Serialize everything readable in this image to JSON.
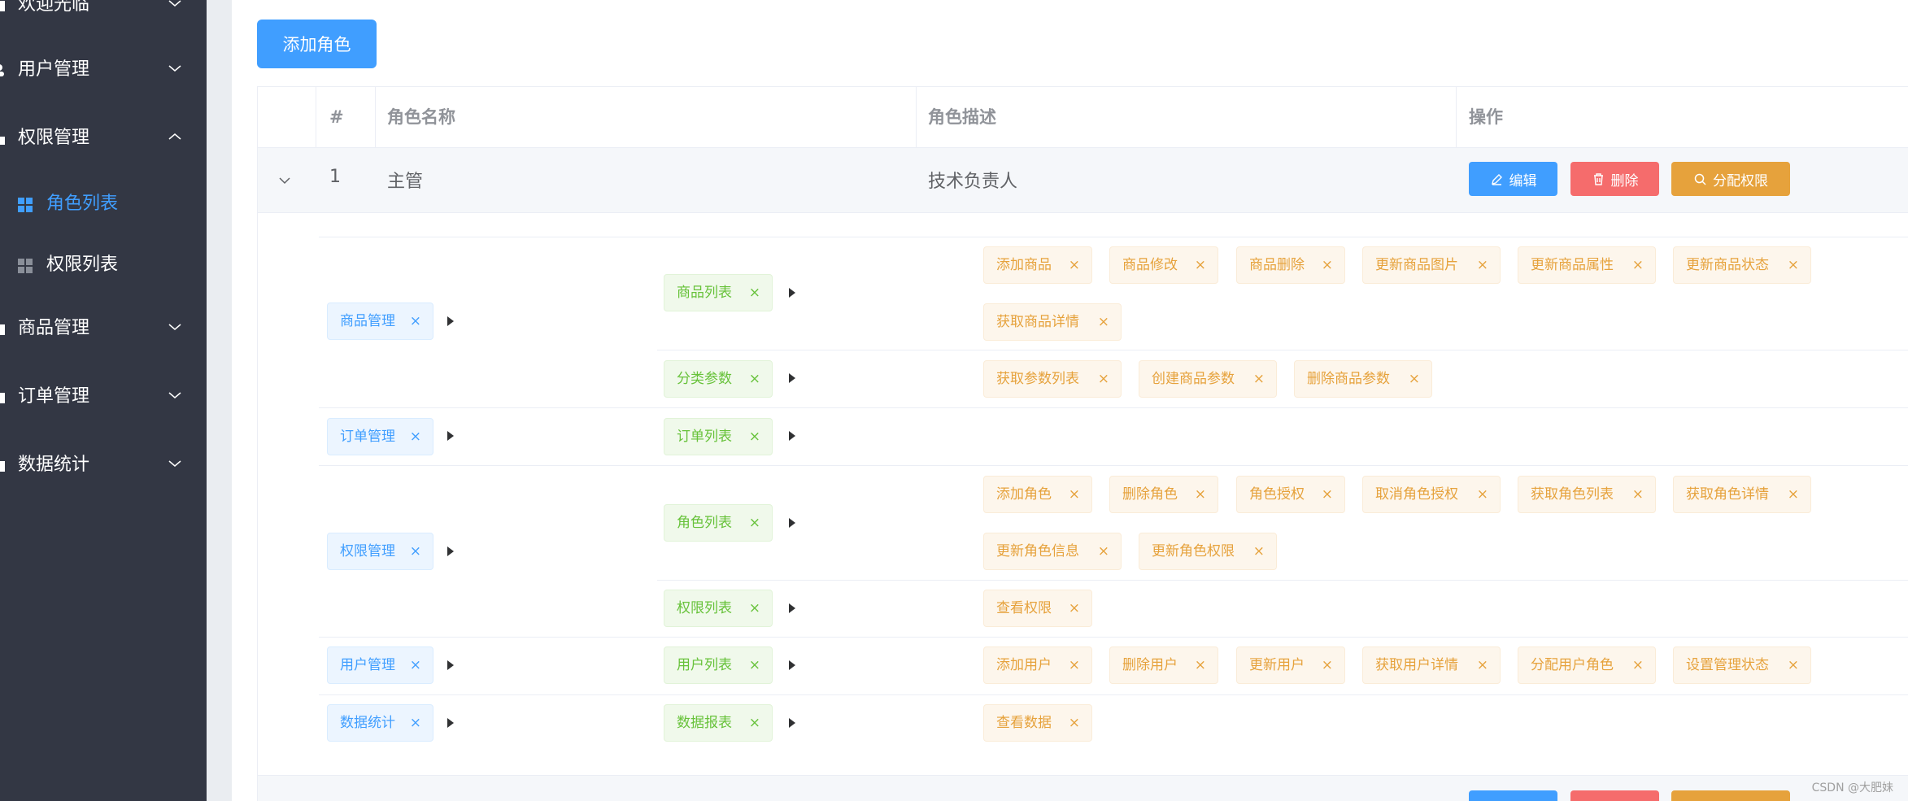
{
  "sidebar": {
    "items": [
      {
        "label": "欢迎光临"
      },
      {
        "label": "用户管理"
      },
      {
        "label": "权限管理"
      },
      {
        "label": "角色列表"
      },
      {
        "label": "权限列表"
      },
      {
        "label": "商品管理"
      },
      {
        "label": "订单管理"
      },
      {
        "label": "数据统计"
      }
    ],
    "active_color": "#409eff",
    "bg_color": "#333744"
  },
  "toolbar": {
    "add_role_label": "添加角色"
  },
  "table": {
    "headers": [
      "#",
      "角色名称",
      "角色描述",
      "操作"
    ],
    "rows": [
      {
        "index": "1",
        "name": "主管",
        "desc": "技术负责人"
      }
    ],
    "actions": {
      "edit": "编辑",
      "delete": "删除",
      "assign": "分配权限"
    }
  },
  "expanded": {
    "groups": [
      {
        "level1": "商品管理",
        "children": [
          {
            "level2": "商品列表",
            "perms": [
              "添加商品",
              "商品修改",
              "商品删除",
              "更新商品图片",
              "更新商品属性",
              "更新商品状态",
              "获取商品详情"
            ]
          },
          {
            "level2": "分类参数",
            "perms": [
              "获取参数列表",
              "创建商品参数",
              "删除商品参数"
            ]
          }
        ]
      },
      {
        "level1": "订单管理",
        "children": [
          {
            "level2": "订单列表",
            "perms": []
          }
        ]
      },
      {
        "level1": "权限管理",
        "children": [
          {
            "level2": "角色列表",
            "perms": [
              "添加角色",
              "删除角色",
              "角色授权",
              "取消角色授权",
              "获取角色列表",
              "获取角色详情",
              "更新角色信息",
              "更新角色权限"
            ]
          },
          {
            "level2": "权限列表",
            "perms": [
              "查看权限"
            ]
          }
        ]
      },
      {
        "level1": "用户管理",
        "children": [
          {
            "level2": "用户列表",
            "perms": [
              "添加用户",
              "删除用户",
              "更新用户",
              "获取用户详情",
              "分配用户角色",
              "设置管理状态"
            ]
          }
        ]
      },
      {
        "level1": "数据统计",
        "children": [
          {
            "level2": "数据报表",
            "perms": [
              "查看数据"
            ]
          }
        ]
      }
    ],
    "close_glyph": "×"
  },
  "watermark": "CSDN @大肥妹"
}
